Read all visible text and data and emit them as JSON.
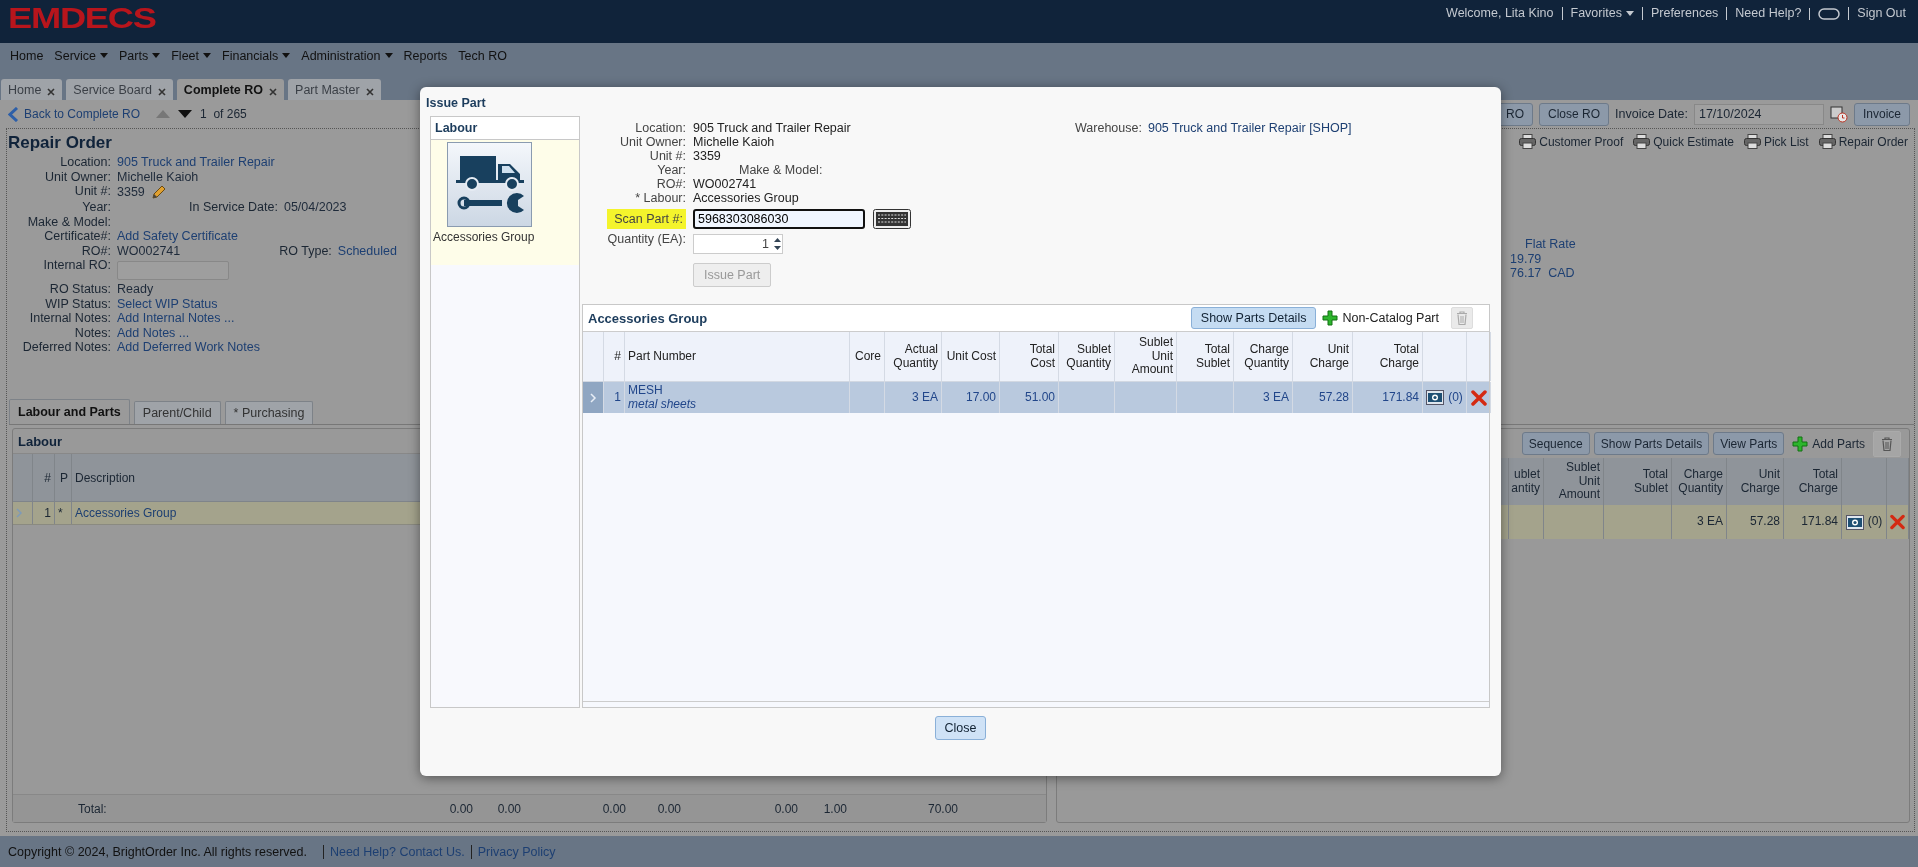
{
  "header": {
    "logo": "EMDECS",
    "welcome": "Welcome, Lita Kino",
    "links": [
      {
        "label": "Favorites",
        "kind": "dropdown"
      },
      {
        "label": "Preferences",
        "kind": "link"
      },
      {
        "label": "Need Help?",
        "kind": "link"
      },
      {
        "kind": "chat"
      },
      {
        "label": "Sign Out",
        "kind": "link"
      }
    ]
  },
  "menu": [
    {
      "label": "Home",
      "dropdown": false
    },
    {
      "label": "Service",
      "dropdown": true
    },
    {
      "label": "Parts",
      "dropdown": true
    },
    {
      "label": "Fleet",
      "dropdown": true
    },
    {
      "label": "Financials",
      "dropdown": true
    },
    {
      "label": "Administration",
      "dropdown": true
    },
    {
      "label": "Reports",
      "dropdown": false
    },
    {
      "label": "Tech RO",
      "dropdown": false
    }
  ],
  "tabs": [
    {
      "label": "Home",
      "selected": false
    },
    {
      "label": "Service Board",
      "selected": false
    },
    {
      "label": "Complete RO",
      "selected": true
    },
    {
      "label": "Part Master",
      "selected": false
    }
  ],
  "toolbar": {
    "back": "Back to Complete RO",
    "pager": "1  of 265",
    "buttons": [
      "RO",
      "Close RO"
    ],
    "invoice_date": {
      "label": "Invoice Date:",
      "value": "17/10/2024"
    },
    "invoice": "Invoice"
  },
  "repair_order": {
    "title": "Repair Order",
    "fields": [
      {
        "label": "Location:",
        "value": "905 Truck and Trailer Repair",
        "kind": "link"
      },
      {
        "label": "Unit Owner:",
        "value": "Michelle Kaioh",
        "kind": "text"
      },
      {
        "label": "Unit #:",
        "value": "3359",
        "kind": "edit"
      },
      {
        "label": "Year:",
        "kind": "text",
        "extra": {
          "label": "In Service Date:",
          "value": "05/04/2023",
          "kind": "text"
        }
      },
      {
        "label": "Make & Model:",
        "kind": "text"
      },
      {
        "label": "Certificate#:",
        "value": "Add Safety Certificate",
        "kind": "link"
      },
      {
        "label": "RO#:",
        "value": "WO002741",
        "kind": "text",
        "extra": {
          "label": "RO Type:",
          "value": "Scheduled",
          "kind": "link"
        }
      },
      {
        "label": "Internal RO:",
        "kind": "input"
      },
      {
        "label": "RO Status:",
        "value": "Ready",
        "kind": "text"
      },
      {
        "label": "WIP Status:",
        "value": "Select WIP Status",
        "kind": "link"
      },
      {
        "label": "Internal Notes:",
        "value": "Add Internal Notes ...",
        "kind": "link"
      },
      {
        "label": "Notes:",
        "value": "Add Notes ...",
        "kind": "link"
      },
      {
        "label": "Deferred Notes:",
        "value": "Add Deferred Work Notes",
        "kind": "link"
      }
    ]
  },
  "print_links": [
    "Customer Proof",
    "Quick Estimate",
    "Pick List",
    "Repair Order"
  ],
  "summary": {
    "heading": "Flat Rate",
    "lines": [
      "19.79",
      "76.17  CAD"
    ]
  },
  "lower_tabs": [
    {
      "label": "Labour and Parts",
      "selected": true
    },
    {
      "label": "Parent/Child",
      "selected": false
    },
    {
      "label": "* Purchasing",
      "selected": false
    }
  ],
  "labour": {
    "title": "Labour",
    "columns": [
      "#",
      "P",
      "Description"
    ],
    "rows": [
      {
        "num": "1",
        "p": "*",
        "description": "Accessories Group",
        "selected": true
      }
    ],
    "total": {
      "label": "Total:",
      "values": [
        "0.00",
        "0.00",
        "0.00",
        "0.00",
        "0.00",
        "1.00",
        "70.00"
      ]
    }
  },
  "parts": {
    "buttons": [
      "Sequence",
      "Show Parts Details",
      "View Parts"
    ],
    "add": "Add Parts",
    "columns": [
      "ublet antity",
      "Sublet Unit Amount",
      "Total Sublet",
      "Charge Quantity",
      "Unit Charge",
      "Total Charge"
    ],
    "rows": [
      {
        "charge_quantity": "3 EA",
        "unit_charge": "57.28",
        "total_charge": "171.84",
        "attachments": "(0)",
        "selected": true
      }
    ]
  },
  "footer": {
    "copyright": "Copyright © 2024, BrightOrder Inc. All rights reserved.",
    "links": [
      "Need Help? Contact Us.",
      "Privacy Policy"
    ]
  },
  "dialog": {
    "title": "Issue Part",
    "labour": {
      "title": "Labour",
      "items": [
        {
          "label": "Accessories Group",
          "selected": true
        }
      ]
    },
    "fields": [
      {
        "label": "Location:",
        "value": "905 Truck and Trailer Repair"
      },
      {
        "label": "Unit Owner:",
        "value": "Michelle Kaioh"
      },
      {
        "label": "Unit #:",
        "value": "3359"
      },
      {
        "label": "Year:",
        "extra_label": "Make & Model:"
      },
      {
        "label": "RO#:",
        "value": "WO002741"
      },
      {
        "label": "* Labour:",
        "value": "Accessories Group"
      }
    ],
    "warehouse": {
      "label": "Warehouse:",
      "value": "905 Truck and Trailer Repair [SHOP]"
    },
    "scan": {
      "label": "Scan Part #:",
      "value": "5968303086030"
    },
    "quantity": {
      "label": "Quantity (EA):",
      "value": "1"
    },
    "issue_button": {
      "label": "Issue Part",
      "disabled": true
    },
    "grid": {
      "title": "Accessories Group",
      "button": "Show Parts Details",
      "add": "Non-Catalog Part",
      "columns": [
        "#",
        "Part Number",
        "Core",
        "Actual Quantity",
        "Unit Cost",
        "Total Cost",
        "Sublet Quantity",
        "Sublet Unit Amount",
        "Total Sublet",
        "Charge Quantity",
        "Unit Charge",
        "Total Charge"
      ],
      "rows": [
        {
          "num": "1",
          "part": "MESH",
          "description": "metal sheets",
          "actual_quantity": "3 EA",
          "unit_cost": "17.00",
          "total_cost": "51.00",
          "charge_quantity": "3 EA",
          "unit_charge": "57.28",
          "total_charge": "171.84",
          "attachments": "(0)",
          "selected": true
        }
      ]
    },
    "close": "Close"
  }
}
